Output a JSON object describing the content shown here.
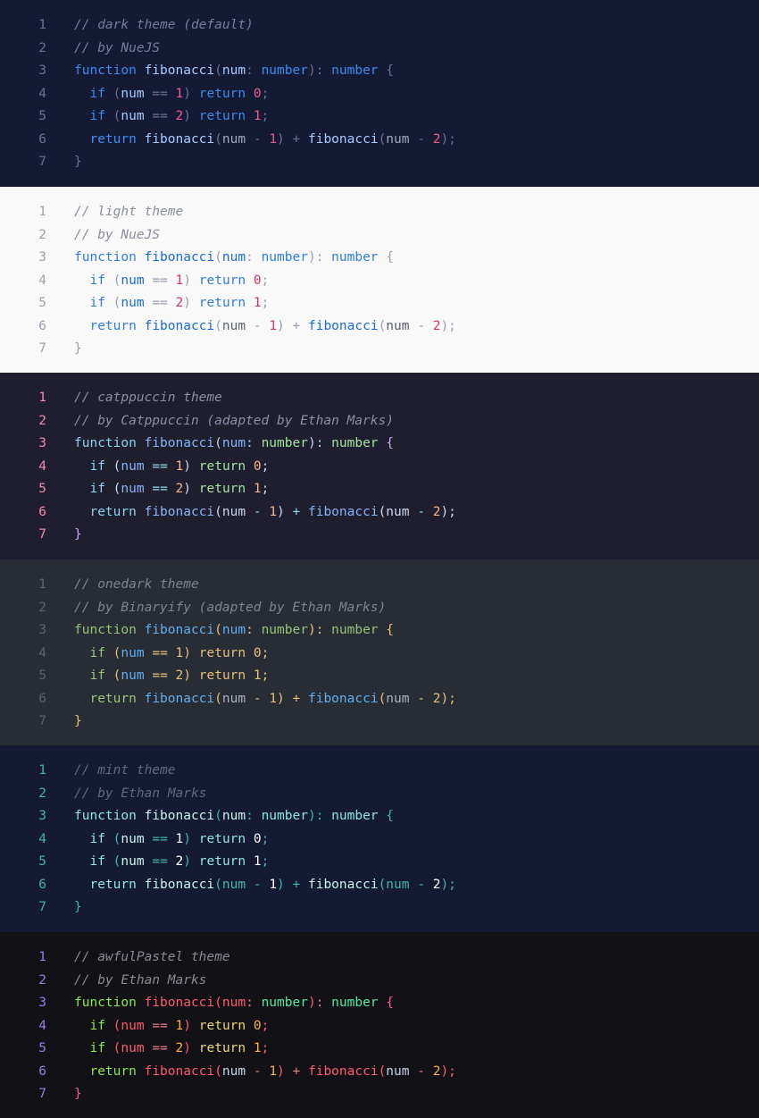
{
  "code_lines": [
    [
      [
        "kw",
        "function"
      ],
      [
        "sp",
        " "
      ],
      [
        "fn",
        "fibonacci"
      ],
      [
        "pn",
        "("
      ],
      [
        "id",
        "num"
      ],
      [
        "op",
        ":"
      ],
      [
        "sp",
        " "
      ],
      [
        "ty",
        "number"
      ],
      [
        "pn",
        ")"
      ],
      [
        "op",
        ":"
      ],
      [
        "sp",
        " "
      ],
      [
        "ty",
        "number"
      ],
      [
        "sp",
        " "
      ],
      [
        "br",
        "{"
      ]
    ],
    [
      [
        "sp",
        "  "
      ],
      [
        "kw",
        "if"
      ],
      [
        "sp",
        " "
      ],
      [
        "pn",
        "("
      ],
      [
        "id",
        "num"
      ],
      [
        "sp",
        " "
      ],
      [
        "op",
        "=="
      ],
      [
        "sp",
        " "
      ],
      [
        "num",
        "1"
      ],
      [
        "pn",
        ")"
      ],
      [
        "sp",
        " "
      ],
      [
        "kw2",
        "return"
      ],
      [
        "sp",
        " "
      ],
      [
        "num",
        "0"
      ],
      [
        "pn",
        ";"
      ]
    ],
    [
      [
        "sp",
        "  "
      ],
      [
        "kw",
        "if"
      ],
      [
        "sp",
        " "
      ],
      [
        "pn",
        "("
      ],
      [
        "id",
        "num"
      ],
      [
        "sp",
        " "
      ],
      [
        "op",
        "=="
      ],
      [
        "sp",
        " "
      ],
      [
        "num",
        "2"
      ],
      [
        "pn",
        ")"
      ],
      [
        "sp",
        " "
      ],
      [
        "kw2",
        "return"
      ],
      [
        "sp",
        " "
      ],
      [
        "num",
        "1"
      ],
      [
        "pn",
        ";"
      ]
    ],
    [
      [
        "sp",
        "  "
      ],
      [
        "kw",
        "return"
      ],
      [
        "sp",
        " "
      ],
      [
        "fn",
        "fibonacci"
      ],
      [
        "pn",
        "("
      ],
      [
        "id2",
        "num"
      ],
      [
        "sp",
        " "
      ],
      [
        "op",
        "-"
      ],
      [
        "sp",
        " "
      ],
      [
        "num",
        "1"
      ],
      [
        "pn",
        ")"
      ],
      [
        "sp",
        " "
      ],
      [
        "op",
        "+"
      ],
      [
        "sp",
        " "
      ],
      [
        "fn",
        "fibonacci"
      ],
      [
        "pn",
        "("
      ],
      [
        "id2",
        "num"
      ],
      [
        "sp",
        " "
      ],
      [
        "op",
        "-"
      ],
      [
        "sp",
        " "
      ],
      [
        "num",
        "2"
      ],
      [
        "pn",
        ")"
      ],
      [
        "pn",
        ";"
      ]
    ],
    [
      [
        "br",
        "}"
      ]
    ]
  ],
  "line_numbers": [
    "1",
    "2",
    "3",
    "4",
    "5",
    "6",
    "7"
  ],
  "themes": [
    {
      "id": "dark",
      "comment1": "// dark theme (default)",
      "comment2": "// by NueJS",
      "colors": {
        "bg": "#141a33",
        "ln": "#6b7290",
        "comment": "#757d99",
        "kw": "#3c8cf0",
        "kw2": "#3c8cf0",
        "fn": "#a6ccff",
        "id": "#a6ccff",
        "id2": "#a1a8bd",
        "op": "#6b7290",
        "pn": "#6b7290",
        "ty": "#3c8cf0",
        "num": "#f05a8c",
        "br": "#6b7290",
        "sp": "#ffffff"
      }
    },
    {
      "id": "light",
      "comment1": "// light theme",
      "comment2": "// by NueJS",
      "colors": {
        "bg": "#f9f9f9",
        "ln": "#9aa0b0",
        "comment": "#8a8f9c",
        "kw": "#2e7de0",
        "kw2": "#2e7de0",
        "fn": "#1a6bd8",
        "id": "#1a6bd8",
        "id2": "#5c6270",
        "op": "#9aa0b0",
        "pn": "#9aa0b0",
        "ty": "#2e7de0",
        "num": "#d8326e",
        "br": "#9aa0b0",
        "sp": "#000000"
      }
    },
    {
      "id": "catppuccin",
      "comment1": "// catppuccin theme",
      "comment2": "// by Catppuccin (adapted by Ethan Marks)",
      "colors": {
        "bg": "#1e1e2e",
        "ln": "#f38ba8",
        "comment": "#8a8fa8",
        "kw": "#8bd5f0",
        "kw2": "#a6e3a1",
        "fn": "#89b4fa",
        "id": "#89b4fa",
        "id2": "#cdd6f4",
        "op": "#89dceb",
        "pn": "#cdd6f4",
        "ty": "#a6e3a1",
        "num": "#fab387",
        "br": "#cba6f7",
        "sp": "#ffffff"
      }
    },
    {
      "id": "onedark",
      "comment1": "// onedark theme",
      "comment2": "// by Binaryify (adapted by Ethan Marks)",
      "colors": {
        "bg": "#282c34",
        "ln": "#5c6370",
        "comment": "#7f848e",
        "kw": "#98c379",
        "kw2": "#e5c07b",
        "fn": "#61afef",
        "id": "#61afef",
        "id2": "#abb2bf",
        "op": "#e5c07b",
        "pn": "#e5c07b",
        "ty": "#98c379",
        "num": "#e5c07b",
        "br": "#e5c07b",
        "sp": "#ffffff"
      }
    },
    {
      "id": "mint",
      "comment1": "// mint theme",
      "comment2": "// by Ethan Marks",
      "colors": {
        "bg": "#141a33",
        "ln": "#40b5a8",
        "comment": "#5e6a7a",
        "kw": "#8de8dc",
        "kw2": "#8de8dc",
        "fn": "#c8f5ef",
        "id": "#c8f5ef",
        "id2": "#40b5a8",
        "op": "#40b5a8",
        "pn": "#40b5a8",
        "ty": "#8de8dc",
        "num": "#ffffff",
        "br": "#40b5a8",
        "sp": "#ffffff"
      }
    },
    {
      "id": "awfulPastel",
      "comment1": "// awfulPastel theme",
      "comment2": "// by Ethan Marks",
      "colors": {
        "bg": "#111116",
        "ln": "#9b7be8",
        "comment": "#8a8a95",
        "kw": "#8de84a",
        "kw2": "#f0d878",
        "fn": "#ff5a6e",
        "id": "#ff5a6e",
        "id2": "#c8d4e8",
        "op": "#f07a8a",
        "pn": "#ff5a6e",
        "ty": "#5ae8a0",
        "num": "#ffb04a",
        "br": "#ff5a9e",
        "sp": "#ffffff"
      }
    }
  ]
}
